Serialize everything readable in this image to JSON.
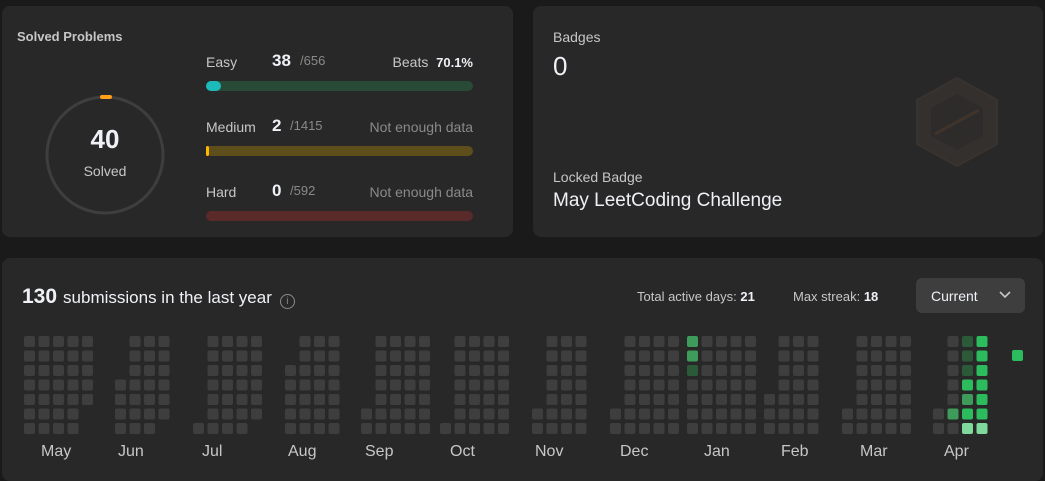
{
  "solved": {
    "title": "Solved Problems",
    "count": "40",
    "label": "Solved",
    "easy": {
      "label": "Easy",
      "count": "38",
      "total": "/656",
      "beats_label": "Beats",
      "beats_value": "70.1%",
      "fraction": 0.058
    },
    "medium": {
      "label": "Medium",
      "count": "2",
      "total": "/1415",
      "note": "Not enough data",
      "fraction": 0.0014
    },
    "hard": {
      "label": "Hard",
      "count": "0",
      "total": "/592",
      "note": "Not enough data",
      "fraction": 0
    }
  },
  "badges": {
    "label": "Badges",
    "count": "0",
    "locked_label": "Locked Badge",
    "locked_name": "May LeetCoding Challenge"
  },
  "submissions": {
    "count": "130",
    "text": "submissions in the last year",
    "active_days_label": "Total active days:",
    "active_days_value": "21",
    "max_streak_label": "Max streak:",
    "max_streak_value": "18",
    "period_button": "Current",
    "months": [
      "May",
      "Jun",
      "Jul",
      "Aug",
      "Sep",
      "Oct",
      "Nov",
      "Dec",
      "Jan",
      "Feb",
      "Mar",
      "Apr"
    ]
  },
  "colors": {
    "easy": "#1cbaba",
    "easy_track": "#2a4a38",
    "medium": "#ffb700",
    "medium_track": "#5e4e1c",
    "hard": "#f63737",
    "hard_track": "#5a2a2a",
    "cell_empty": "#3e3e3e",
    "cell_l1": "#2c5a38",
    "cell_l2": "#3f9b5a",
    "cell_l3": "#2cbb5d",
    "cell_l4": "#7fd99c"
  }
}
